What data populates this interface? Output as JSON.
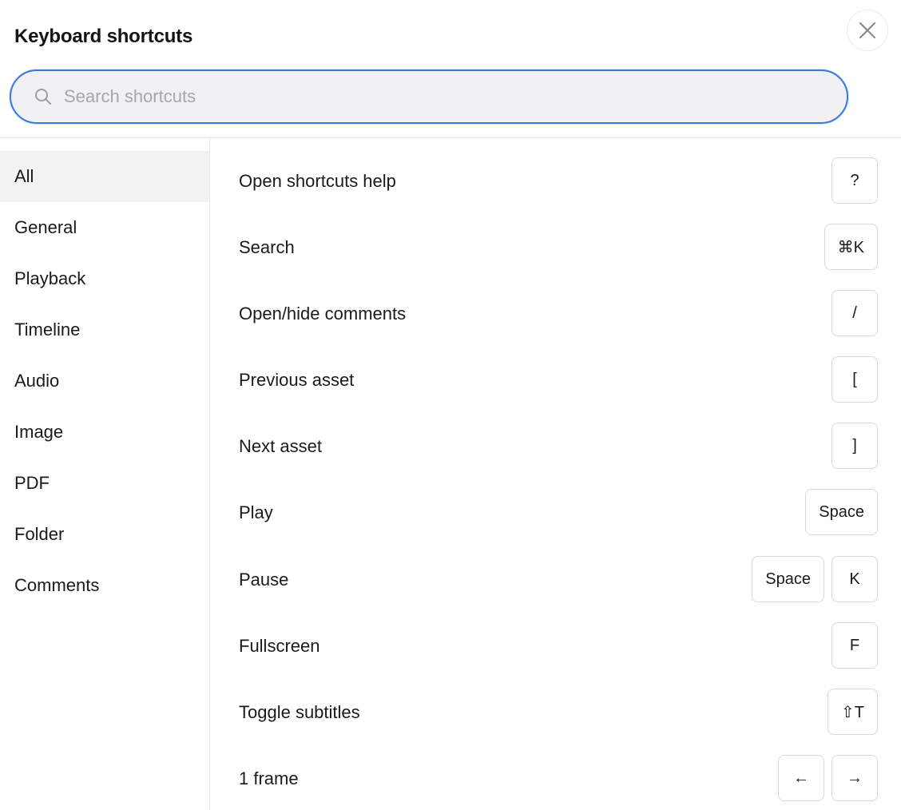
{
  "dialog": {
    "title": "Keyboard shortcuts",
    "close_icon": "close-icon"
  },
  "search": {
    "placeholder": "Search shortcuts",
    "value": "",
    "icon": "search-icon"
  },
  "sidebar": {
    "items": [
      {
        "label": "All",
        "active": true
      },
      {
        "label": "General",
        "active": false
      },
      {
        "label": "Playback",
        "active": false
      },
      {
        "label": "Timeline",
        "active": false
      },
      {
        "label": "Audio",
        "active": false
      },
      {
        "label": "Image",
        "active": false
      },
      {
        "label": "PDF",
        "active": false
      },
      {
        "label": "Folder",
        "active": false
      },
      {
        "label": "Comments",
        "active": false
      }
    ]
  },
  "shortcuts": [
    {
      "label": "Open shortcuts help",
      "keys": [
        "?"
      ]
    },
    {
      "label": "Search",
      "keys": [
        "⌘K"
      ]
    },
    {
      "label": "Open/hide comments",
      "keys": [
        "/"
      ]
    },
    {
      "label": "Previous asset",
      "keys": [
        "["
      ]
    },
    {
      "label": "Next asset",
      "keys": [
        "]"
      ]
    },
    {
      "label": "Play",
      "keys": [
        "Space"
      ]
    },
    {
      "label": "Pause",
      "keys": [
        "Space",
        "K"
      ]
    },
    {
      "label": "Fullscreen",
      "keys": [
        "F"
      ]
    },
    {
      "label": "Toggle subtitles",
      "keys": [
        "⇧T"
      ]
    },
    {
      "label": "1 frame",
      "keys": [
        "←",
        "→"
      ]
    }
  ],
  "colors": {
    "accent": "#3b78d8",
    "active_bg": "#f2f2f3",
    "border": "#ebebeb"
  }
}
